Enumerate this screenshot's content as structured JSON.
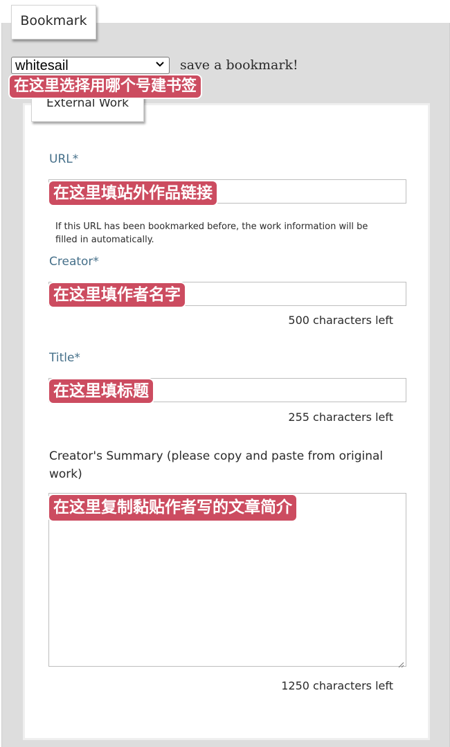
{
  "bookmark_tab": {
    "label": "Bookmark"
  },
  "pseud": {
    "selected": "whitesail",
    "after_text": "save a bookmark!"
  },
  "annotations": {
    "pseud": "在这里选择用哪个号建书签",
    "url": "在这里填站外作品链接",
    "creator": "在这里填作者名字",
    "title": "在这里填标题",
    "summary": "在这里复制黏贴作者写的文章简介"
  },
  "external_work": {
    "legend": "External Work",
    "url": {
      "label": "URL*",
      "help": "If this URL has been bookmarked before, the work information will be filled in automatically."
    },
    "creator": {
      "label": "Creator*",
      "chars_left": "500 characters left"
    },
    "title": {
      "label": "Title*",
      "chars_left": "255 characters left"
    },
    "summary": {
      "label": "Creator's Summary  (please copy and paste from original work)",
      "chars_left": "1250 characters left"
    }
  },
  "colors": {
    "annotation_bg": "#cc4c60",
    "label_blue": "#46708a",
    "panel_gray": "#dddddd"
  }
}
